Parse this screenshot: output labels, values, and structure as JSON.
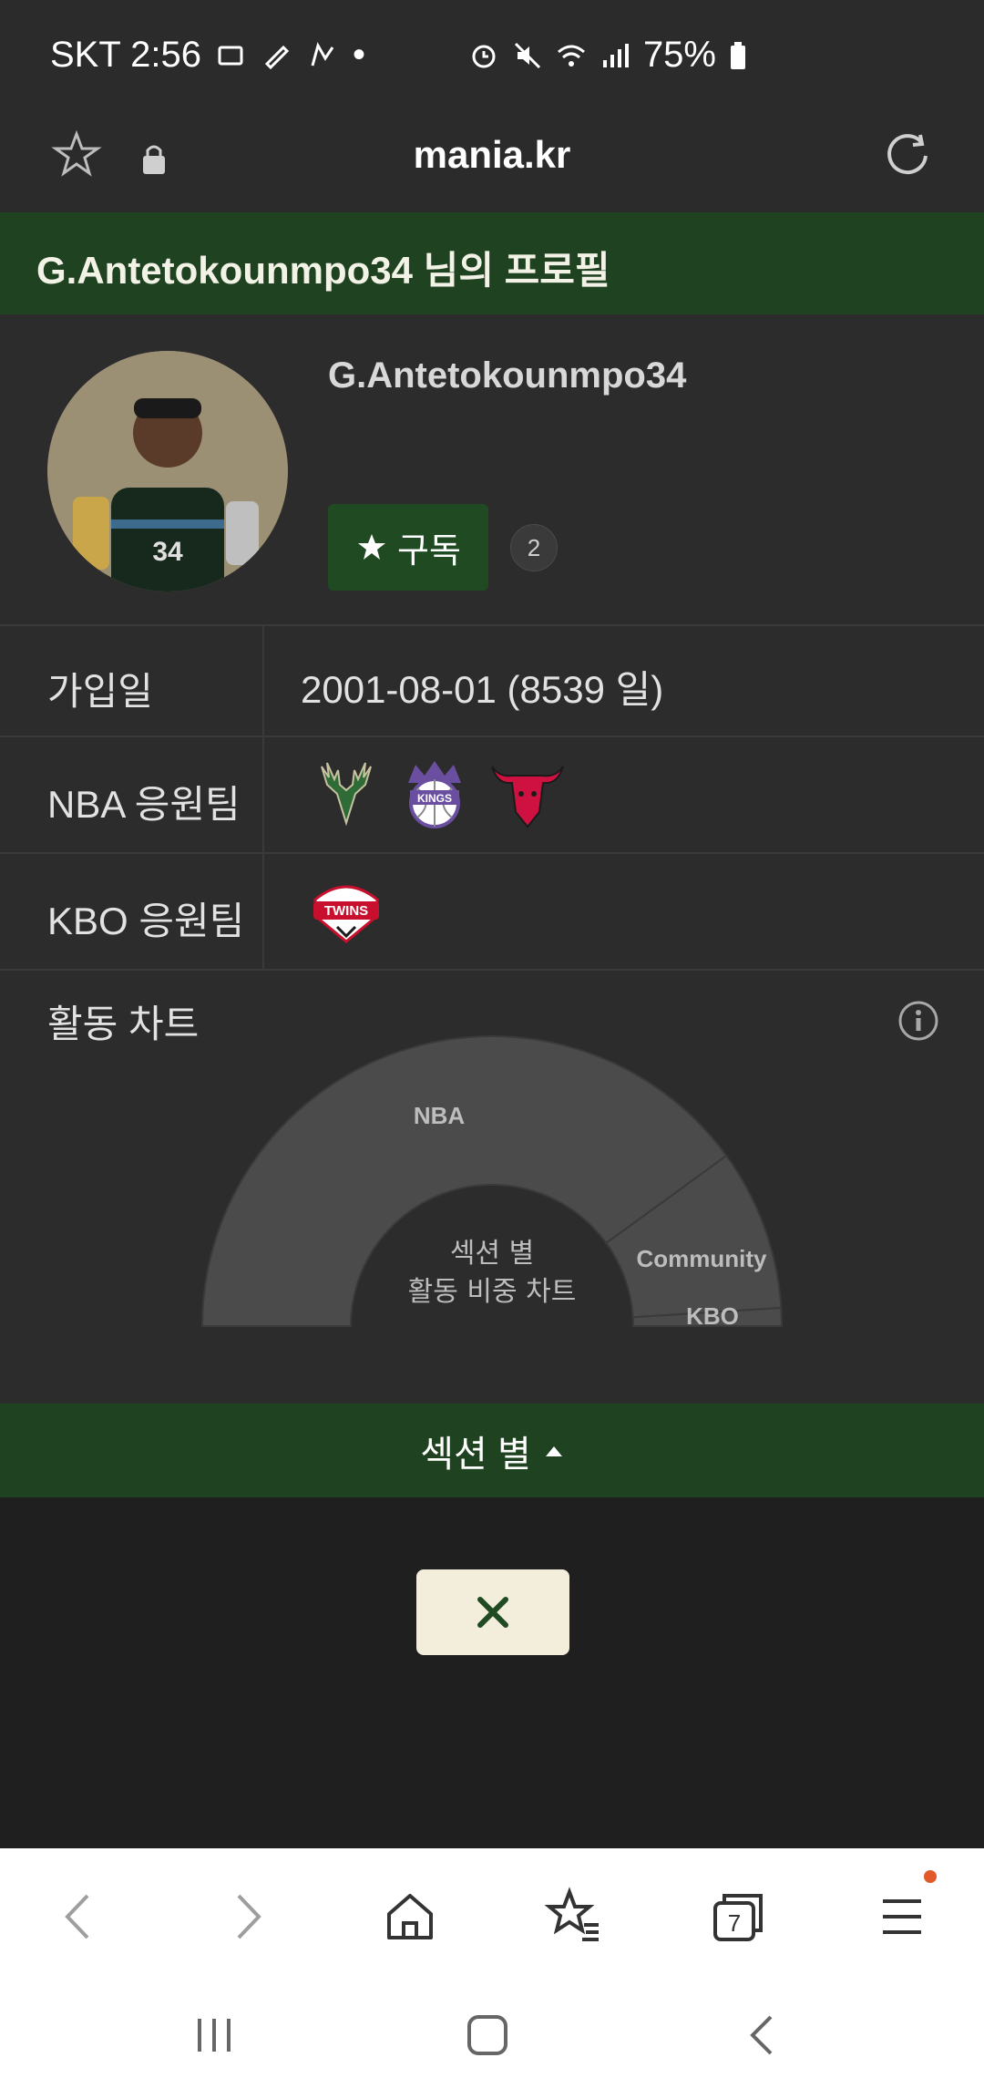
{
  "status_bar": {
    "carrier_time": "SKT 2:56",
    "battery": "75%"
  },
  "browser": {
    "url": "mania.kr"
  },
  "profile": {
    "header": "G.Antetokounmpo34 님의 프로필",
    "username": "G.Antetokounmpo34",
    "subscribe_label": "구독",
    "subscriber_count": "2",
    "join_label": "가입일",
    "join_value": "2001-08-01 (8539 일)",
    "nba_label": "NBA 응원팀",
    "kbo_label": "KBO 응원팀",
    "nba_teams": [
      "bucks-logo",
      "kings-logo",
      "bulls-logo"
    ],
    "kbo_teams": [
      "twins-logo"
    ],
    "kings_logo_text": "KINGS",
    "twins_logo_text": "TWINS"
  },
  "activity": {
    "title": "활동 차트",
    "section_label": "섹션 별"
  },
  "chart_data": {
    "type": "pie",
    "variant": "semi-donut",
    "center_text": [
      "섹션 별",
      "활동 비중 차트"
    ],
    "categories": [
      "NBA",
      "Community",
      "KBO"
    ],
    "values": [
      80,
      18,
      2
    ],
    "colors": {
      "segment": "#4b4b4b",
      "text": "#bdbdbd"
    }
  },
  "colors": {
    "brand_green": "#1f4320",
    "background": "#2c2c2c"
  }
}
